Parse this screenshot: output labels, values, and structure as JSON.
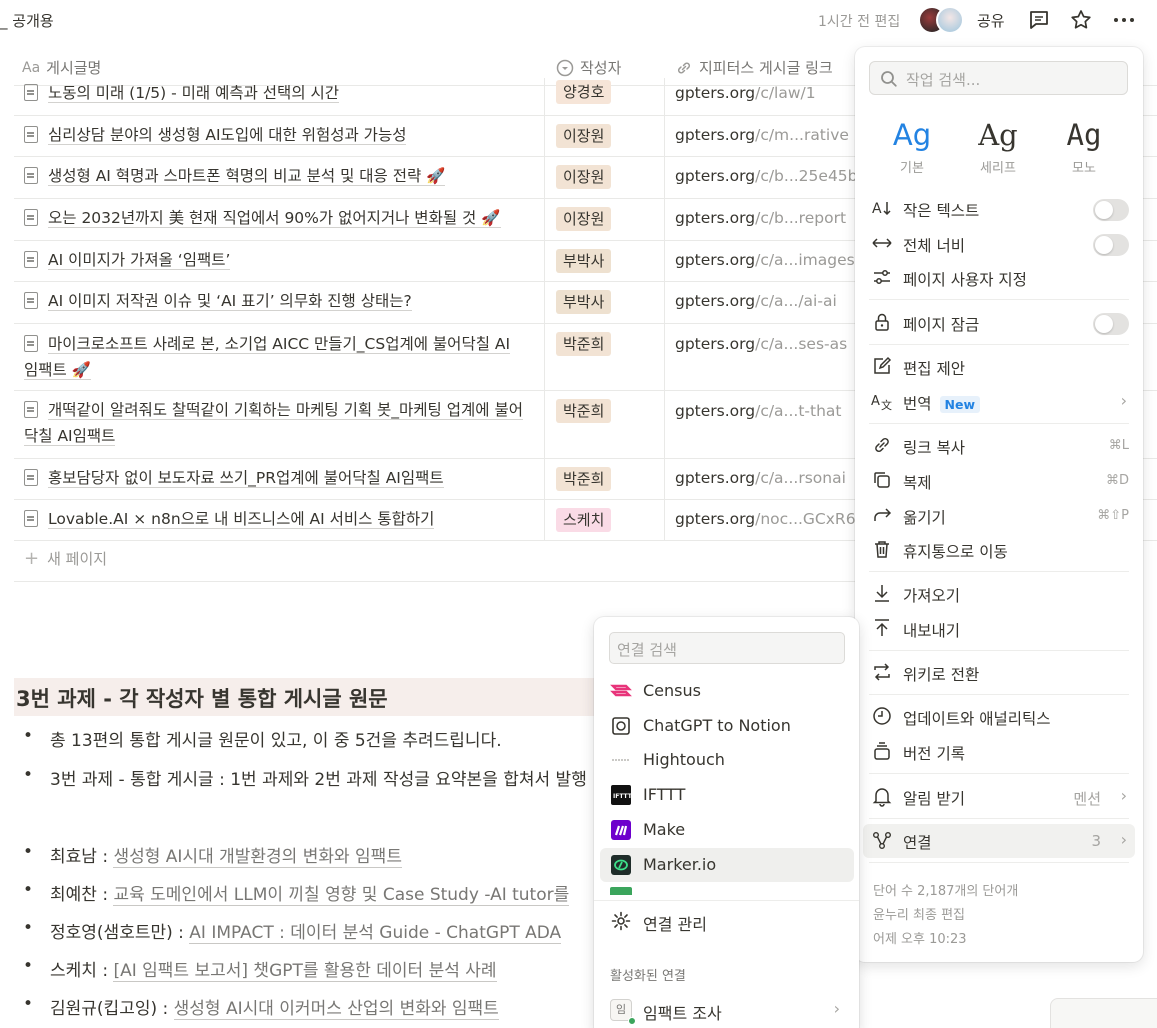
{
  "topbar": {
    "breadcrumb": "_ 공개용",
    "edited": "1시간 전 편집",
    "share": "공유"
  },
  "table": {
    "headers": {
      "title": "게시글명",
      "title_prefix": "Aa",
      "author": "작성자",
      "link": "지피터스 게시글 링크"
    },
    "rows": [
      {
        "title": "노동의 미래 (1/5) - 미래 예측과 선택의 시간",
        "author": "양경호",
        "domain": "gpters.org",
        "path": "/c/law/1"
      },
      {
        "title": "심리상담 분야의 생성형 AI도입에 대한 위험성과 가능성",
        "author": "이장원",
        "domain": "gpters.org",
        "path": "/c/m...rative"
      },
      {
        "title": "생성형 AI 혁명과 스마트폰 혁명의 비교 분석 및 대응 전략 🚀",
        "author": "이장원",
        "domain": "gpters.org",
        "path": "/c/b...25e45b"
      },
      {
        "title": "오는 2032년까지 美 현재 직업에서 90%가 없어지거나 변화될 것 🚀",
        "author": "이장원",
        "domain": "gpters.org",
        "path": "/c/b...report"
      },
      {
        "title": "AI 이미지가 가져올 ‘임팩트’",
        "author": "부박사",
        "domain": "gpters.org",
        "path": "/c/a...images"
      },
      {
        "title": "AI 이미지 저작권 이슈 및 ‘AI 표기’ 의무화 진행 상태는?",
        "author": "부박사",
        "domain": "gpters.org",
        "path": "/c/a.../ai-ai"
      },
      {
        "title_line1": "마이크로소프트 사례로 본, 소기업 AICC 만들기_CS업계에 불어닥칠 AI",
        "title_line2": "임팩트 🚀",
        "author": "박준희",
        "domain": "gpters.org",
        "path": "/c/a...ses-as"
      },
      {
        "title_line1": "개떡같이 알려줘도 찰떡같이 기획하는 마케팅 기획 봇_마케팅 업계에 불어",
        "title_line2": "닥칠 AI임팩트",
        "author": "박준희",
        "domain": "gpters.org",
        "path": "/c/a...t-that"
      },
      {
        "title": "홍보담당자 없이 보도자료 쓰기_PR업계에 불어닥칠 AI임팩트",
        "author": "박준희",
        "domain": "gpters.org",
        "path": "/c/a...rsonai"
      },
      {
        "title": "Lovable.AI × n8n으로 내 비즈니스에 AI 서비스 통합하기",
        "author": "스케치",
        "domain": "gpters.org",
        "path": "/noc...GCxR6"
      }
    ],
    "new_page": "새 페이지"
  },
  "doc": {
    "heading": "3번 과제 - 각 작성자 별 통합 게시글 원문",
    "bullets": [
      "총 13편의 통합 게시글 원문이 있고, 이 중 5건을 추려드립니다.",
      "3번 과제 - 통합 게시글 : 1번 과제와 2번 과제 작성글 요약본을 합쳐서 발행"
    ],
    "links": [
      {
        "name": "최효남 : ",
        "link": "생성형 AI시대 개발환경의 변화와 임팩트"
      },
      {
        "name": "최예찬 : ",
        "link": "교육 도메인에서 LLM이 끼칠 영향 및 Case Study -AI tutor를"
      },
      {
        "name": "정호영(샘호트만) : ",
        "link": "AI IMPACT : 데이터 분석 Guide  - ChatGPT ADA"
      },
      {
        "name": "스케치 : ",
        "link": "[AI 임팩트 보고서] 챗GPT를 활용한 데이터 분석 사례"
      },
      {
        "name": "김원규(킵고잉) : ",
        "link": "생성형 AI시대 이커머스 산업의 변화와 임팩트"
      }
    ]
  },
  "menu": {
    "search_placeholder": "작업 검색...",
    "fonts": [
      {
        "sample": "Ag",
        "label": "기본",
        "color": "#2383e2"
      },
      {
        "sample": "Ag",
        "label": "세리프",
        "color": "#37352f"
      },
      {
        "sample": "Ag",
        "label": "모노",
        "color": "#37352f"
      }
    ],
    "small_text": "작은 텍스트",
    "full_width": "전체 너비",
    "customize": "페이지 사용자 지정",
    "lock": "페이지 잠금",
    "suggest": "편집 제안",
    "translate": "번역",
    "new_badge": "New",
    "copy_link": "링크 복사",
    "copy_link_sc": "⌘L",
    "duplicate": "복제",
    "duplicate_sc": "⌘D",
    "move": "옮기기",
    "move_sc": "⌘⇧P",
    "trash": "휴지통으로 이동",
    "import": "가져오기",
    "export": "내보내기",
    "wiki": "위키로 전환",
    "analytics": "업데이트와 애널리틱스",
    "history": "버전 기록",
    "notify": "알림 받기",
    "notify_value": "멘션",
    "connections": "연결",
    "connections_count": "3",
    "word_count": "단어 수 2,187개의 단어개",
    "last_editor": "윤누리 최종 편집",
    "last_edited": "어제 오후 10:23"
  },
  "connections_menu": {
    "search_placeholder": "연결 검색",
    "items": [
      {
        "label": "Census",
        "color": "#e8347a"
      },
      {
        "label": "ChatGPT to Notion",
        "color": "#37352f"
      },
      {
        "label": "Hightouch",
        "color": "#b8b7b4"
      },
      {
        "label": "IFTTT",
        "color": "#111111"
      },
      {
        "label": "Make",
        "color": "#6d00cc"
      },
      {
        "label": "Marker.io",
        "color": "#1f2d2a"
      }
    ],
    "manage": "연결 관리",
    "active_section": "활성화된 연결",
    "active_item": "임팩트 조사",
    "active_item_avatar": "임"
  },
  "colors": {
    "author_yang": "#f6e5d8",
    "author_lee": "#f2e3d4",
    "author_bu": "#eee1d0",
    "author_park": "#f2e3d4",
    "author_sketch": "#fadbe6",
    "heading_bg": "#f6eeeb",
    "accent": "#2383e2"
  }
}
